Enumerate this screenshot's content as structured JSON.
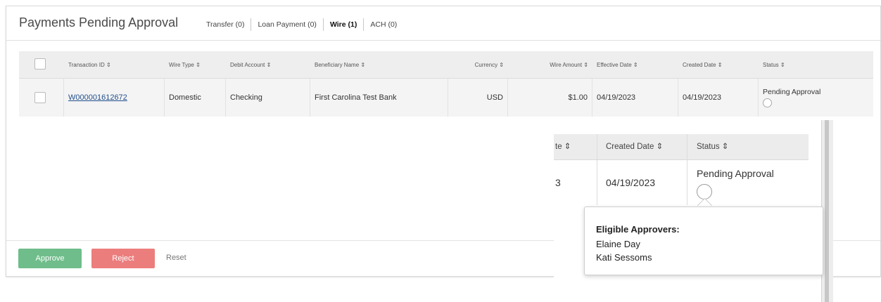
{
  "panel": {
    "title": "Payments Pending Approval",
    "tabs": [
      {
        "label": "Transfer (0)",
        "active": false
      },
      {
        "label": "Loan Payment (0)",
        "active": false
      },
      {
        "label": "Wire (1)",
        "active": true
      },
      {
        "label": "ACH (0)",
        "active": false
      }
    ]
  },
  "grid": {
    "headers": {
      "transaction_id": "Transaction ID ⇕",
      "wire_type": "Wire Type ⇕",
      "debit_account": "Debit Account ⇕",
      "beneficiary_name": "Beneficiary Name ⇕",
      "currency": "Currency ⇕",
      "wire_amount": "Wire Amount ⇕",
      "effective_date": "Effective Date ⇕",
      "created_date": "Created Date ⇕",
      "status": "Status ⇕"
    },
    "rows": [
      {
        "transaction_id": "W000001612672",
        "wire_type": "Domestic",
        "debit_account": "Checking",
        "beneficiary_name": "First Carolina Test Bank",
        "currency": "USD",
        "wire_amount": "$1.00",
        "effective_date": "04/19/2023",
        "created_date": "04/19/2023",
        "status": "Pending Approval"
      }
    ]
  },
  "footer": {
    "approve_label": "Approve",
    "reject_label": "Reject",
    "reset_label": "Reset"
  },
  "zoom": {
    "headers": {
      "effective_fragment": "te ⇕",
      "created_date": "Created Date ⇕",
      "status": "Status ⇕"
    },
    "row": {
      "effective_fragment": "3",
      "created_date": "04/19/2023",
      "status": "Pending Approval"
    }
  },
  "popover": {
    "title": "Eligible Approvers:",
    "approvers": [
      "Elaine Day",
      "Kati Sessoms"
    ]
  },
  "colors": {
    "approve": "#6fbd8a",
    "reject": "#ec7d7d",
    "link": "#1f4e8c"
  }
}
